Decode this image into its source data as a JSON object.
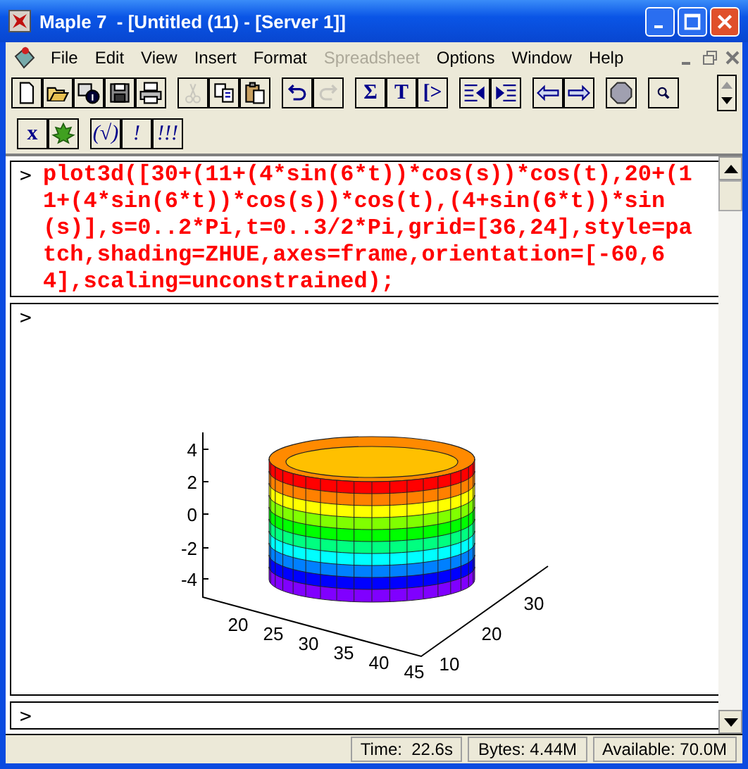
{
  "window": {
    "title": "Maple 7  - [Untitled (11) - [Server 1]]"
  },
  "menu": [
    {
      "label": "File",
      "disabled": false
    },
    {
      "label": "Edit",
      "disabled": false
    },
    {
      "label": "View",
      "disabled": false
    },
    {
      "label": "Insert",
      "disabled": false
    },
    {
      "label": "Format",
      "disabled": false
    },
    {
      "label": "Spreadsheet",
      "disabled": true
    },
    {
      "label": "Options",
      "disabled": false
    },
    {
      "label": "Window",
      "disabled": false
    },
    {
      "label": "Help",
      "disabled": false
    }
  ],
  "toolbar": [
    [
      {
        "kind": "new",
        "disabled": false
      },
      {
        "kind": "open",
        "disabled": false
      },
      {
        "kind": "info",
        "disabled": false
      },
      {
        "kind": "save",
        "disabled": false
      },
      {
        "kind": "print",
        "disabled": false
      }
    ],
    [
      {
        "kind": "cut",
        "disabled": true
      },
      {
        "kind": "copy",
        "disabled": false
      },
      {
        "kind": "paste",
        "disabled": false
      }
    ],
    [
      {
        "kind": "undo",
        "disabled": false
      },
      {
        "kind": "redo",
        "disabled": true
      }
    ],
    [
      {
        "kind": "glyph",
        "label": "Σ",
        "disabled": false
      },
      {
        "kind": "glyph",
        "label": "T",
        "disabled": false
      },
      {
        "kind": "glyph",
        "label": "[>",
        "disabled": false
      }
    ],
    [
      {
        "kind": "outdent",
        "disabled": false
      },
      {
        "kind": "indent",
        "disabled": false
      }
    ],
    [
      {
        "kind": "back",
        "disabled": false
      },
      {
        "kind": "forward",
        "disabled": false
      }
    ],
    [
      {
        "kind": "stop",
        "disabled": false
      }
    ],
    [
      {
        "kind": "zoom",
        "disabled": false
      }
    ]
  ],
  "context_toolbar": [
    [
      {
        "kind": "glyph",
        "label": "x",
        "disabled": false
      },
      {
        "kind": "leaf",
        "disabled": false
      }
    ],
    [
      {
        "kind": "glyph",
        "label": "(√)",
        "disabled": false
      },
      {
        "kind": "glyph",
        "label": "!",
        "disabled": false
      },
      {
        "kind": "glyph",
        "label": "!!!",
        "disabled": false
      }
    ]
  ],
  "worksheet": {
    "command_prompt": ">",
    "command": "plot3d([30+(11+(4*sin(6*t))*cos(s))*cos(t),20+(11+(4*sin(6*t))*cos(s))*cos(t),(4+sin(6*t))*sin(s)],s=0..2*Pi,t=0..3/2*Pi,grid=[36,24],style=patch,shading=ZHUE,axes=frame,orientation=[-60,64],scaling=unconstrained);",
    "output_prompt": ">",
    "plot": {
      "z_ticks": [
        "4",
        "2",
        "0",
        "-2",
        "-4"
      ],
      "x_ticks": [
        "20",
        "25",
        "30",
        "35",
        "40",
        "45"
      ],
      "y_ticks": [
        "10",
        "20",
        "30"
      ]
    },
    "last_prompt": ">"
  },
  "status_bar": {
    "time": "Time:  22.6s",
    "bytes": "Bytes: 4.44M",
    "available": "Available: 70.0M"
  }
}
